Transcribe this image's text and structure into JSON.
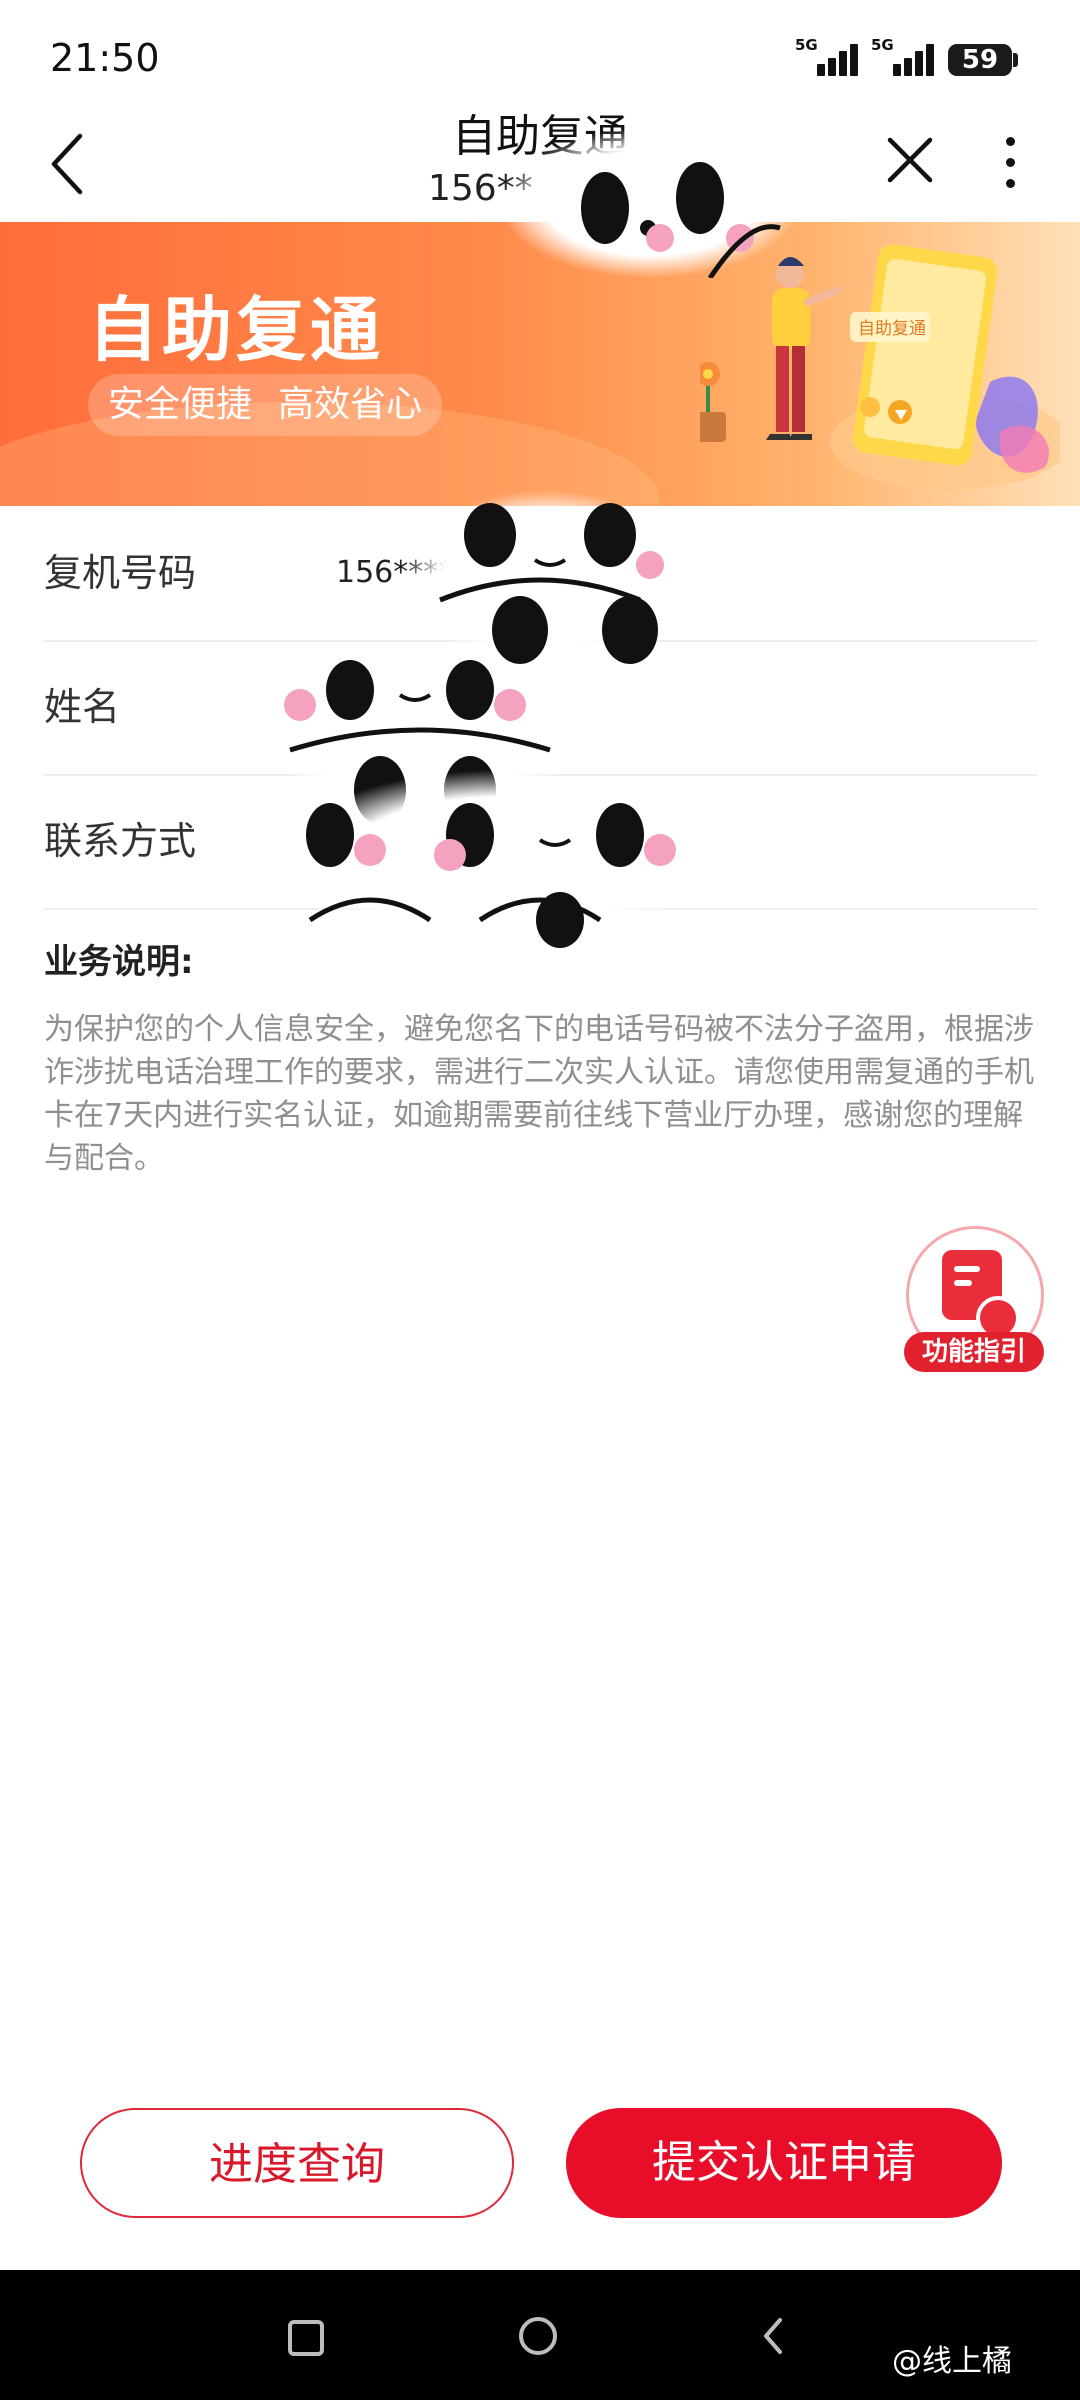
{
  "status_bar": {
    "time": "21:50",
    "network1": "5G",
    "network2": "5G",
    "battery": "59"
  },
  "nav": {
    "title": "自助复通",
    "subtitle": "156**"
  },
  "banner": {
    "title": "自助复通",
    "tag1": "安全便捷",
    "tag2": "高效省心",
    "phone_label": "自助复通"
  },
  "form": {
    "rows": [
      {
        "label": "复机号码",
        "value": "156****"
      },
      {
        "label": "姓名",
        "value": ""
      },
      {
        "label": "联系方式",
        "value": ""
      }
    ]
  },
  "description": {
    "title": "业务说明:",
    "text": "为保护您的个人信息安全，避免您名下的电话号码被不法分子盗用，根据涉诈涉扰电话治理工作的要求，需进行二次实人认证。请您使用需复通的手机卡在7天内进行实名认证，如逾期需要前往线下营业厅办理，感谢您的理解与配合。"
  },
  "guide": {
    "label": "功能指引"
  },
  "buttons": {
    "progress": "进度查询",
    "submit": "提交认证申请"
  },
  "watermark": "@线上橘",
  "colors": {
    "brand_red": "#e80e2a",
    "banner_orange": "#ff6d3b",
    "text_gray": "#8f8f8f"
  },
  "icons": [
    "back-icon",
    "close-icon",
    "more-icon",
    "document-icon",
    "home-icon",
    "recents-icon"
  ]
}
